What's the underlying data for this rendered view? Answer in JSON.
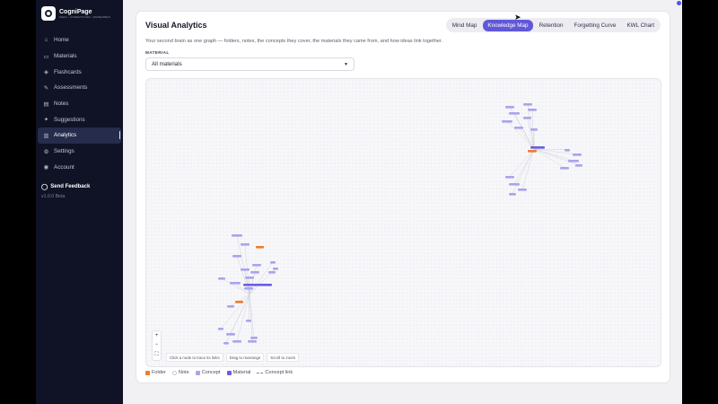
{
  "app": {
    "name": "CogniPage",
    "tagline": "SEEK • UNDERSTAND • REMEMBER",
    "version": "v1.0.0 Beta"
  },
  "sidebar": {
    "items": [
      {
        "label": "Home",
        "icon": "home-icon",
        "glyph": "⌂",
        "active": false
      },
      {
        "label": "Materials",
        "icon": "folder-icon",
        "glyph": "▭",
        "active": false
      },
      {
        "label": "Flashcards",
        "icon": "layers-icon",
        "glyph": "◈",
        "active": false
      },
      {
        "label": "Assessments",
        "icon": "pen-icon",
        "glyph": "✎",
        "active": false
      },
      {
        "label": "Notes",
        "icon": "note-icon",
        "glyph": "▤",
        "active": false
      },
      {
        "label": "Suggestions",
        "icon": "sparkle-icon",
        "glyph": "✦",
        "active": false
      },
      {
        "label": "Analytics",
        "icon": "bar-chart-icon",
        "glyph": "▥",
        "active": true
      },
      {
        "label": "Settings",
        "icon": "gear-icon",
        "glyph": "⚙",
        "active": false
      },
      {
        "label": "Account",
        "icon": "user-icon",
        "glyph": "◉",
        "active": false
      }
    ],
    "feedback_label": "Send Feedback"
  },
  "page": {
    "title": "Visual Analytics",
    "subtitle": "Your second brain as one graph — folders, notes, the concepts they cover, the materials they came from, and how ideas link together.",
    "tabs": [
      {
        "label": "Mind Map",
        "active": false
      },
      {
        "label": "Knowledge Map",
        "active": true
      },
      {
        "label": "Retention",
        "active": false
      },
      {
        "label": "Forgetting Curve",
        "active": false
      },
      {
        "label": "KWL Chart",
        "active": false
      }
    ],
    "material_label": "MATERIAL",
    "material_value": "All materials"
  },
  "graph": {
    "zoom_in": "+",
    "zoom_out": "−",
    "fit": "⛶",
    "hints": [
      "Click a node to trace its links",
      "Drag to rearrange",
      "Scroll to zoom"
    ]
  },
  "legend": [
    {
      "label": "Folder",
      "kind": "folder"
    },
    {
      "label": "Note",
      "kind": "note"
    },
    {
      "label": "Concept",
      "kind": "concept"
    },
    {
      "label": "Material",
      "kind": "material"
    },
    {
      "label": "Concept link",
      "kind": "link"
    }
  ],
  "colors": {
    "accent": "#6157d9",
    "folder": "#f07c24",
    "concept": "#a9a4ec",
    "material": "#6a5fe0",
    "sidebar_bg": "#0f1325"
  }
}
